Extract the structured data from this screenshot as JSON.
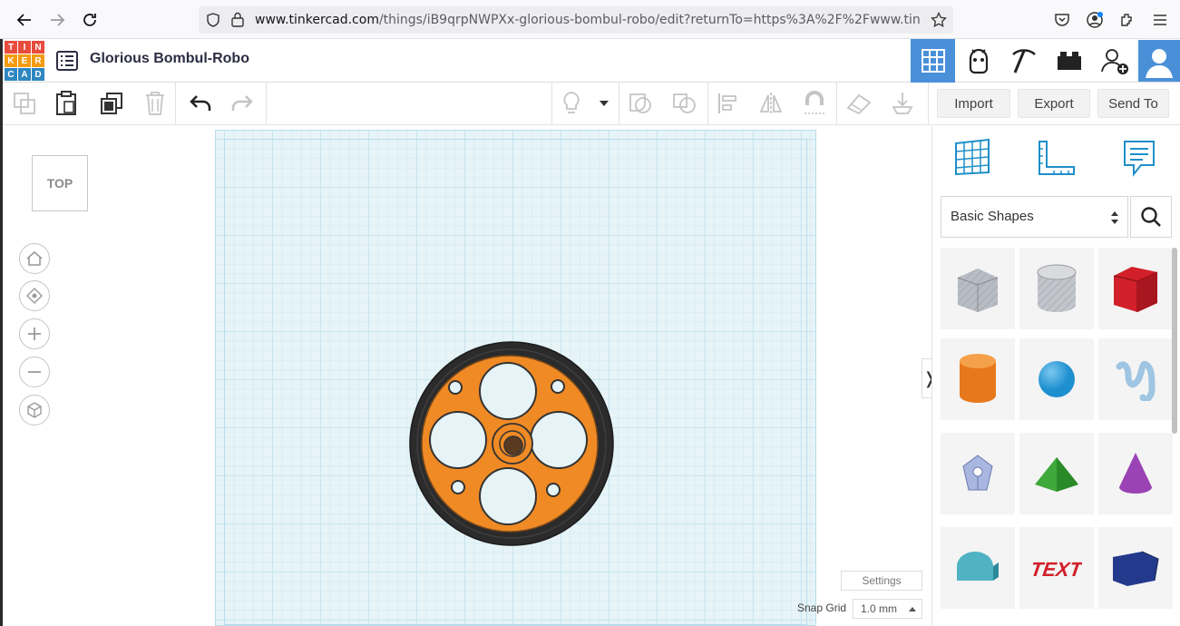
{
  "browser": {
    "url_domain": "www.tinkercad.com",
    "url_rest": "/things/iB9qrpNWPXx-glorious-bombul-robo/edit?returnTo=https%3A%2F%2Fwww.tin"
  },
  "app": {
    "logo_letters": [
      "T",
      "I",
      "N",
      "K",
      "E",
      "R",
      "C",
      "A",
      "D"
    ],
    "logo_colors": [
      "#e84c3d",
      "#e84c3d",
      "#e84c3d",
      "#f39c12",
      "#f39c12",
      "#f39c12",
      "#2e86c1",
      "#2e86c1",
      "#2e86c1"
    ],
    "design_title": "Glorious Bombul-Robo"
  },
  "toolbar": {
    "import_label": "Import",
    "export_label": "Export",
    "send_to_label": "Send To"
  },
  "view": {
    "viewcube_label": "TOP"
  },
  "workplane": {
    "settings_label": "Settings",
    "snap_grid_label": "Snap Grid",
    "snap_grid_value": "1.0 mm",
    "collapse_glyph": "❭"
  },
  "panel": {
    "library_selected": "Basic Shapes",
    "shapes": [
      {
        "name": "Box (hole)",
        "color": "#b8bcc4"
      },
      {
        "name": "Cylinder (hole)",
        "color": "#c2c5cc"
      },
      {
        "name": "Box",
        "color": "#d1202a"
      },
      {
        "name": "Cylinder",
        "color": "#e8781c"
      },
      {
        "name": "Sphere",
        "color": "#1e8fcf"
      },
      {
        "name": "Scribble",
        "color": "#9ec5e2"
      },
      {
        "name": "Shape Generator",
        "color": "#a9b7e0"
      },
      {
        "name": "Roof",
        "color": "#3ea83a"
      },
      {
        "name": "Cone",
        "color": "#9a43b4"
      },
      {
        "name": "Round Roof",
        "color": "#4fb3c4"
      },
      {
        "name": "Text",
        "color": "#d1202a"
      },
      {
        "name": "Wedge",
        "color": "#233a8c"
      }
    ]
  },
  "colors": {
    "accent_blue": "#4a90d9",
    "wheel_orange": "#f08a24",
    "tire_black": "#2b2b2b"
  }
}
